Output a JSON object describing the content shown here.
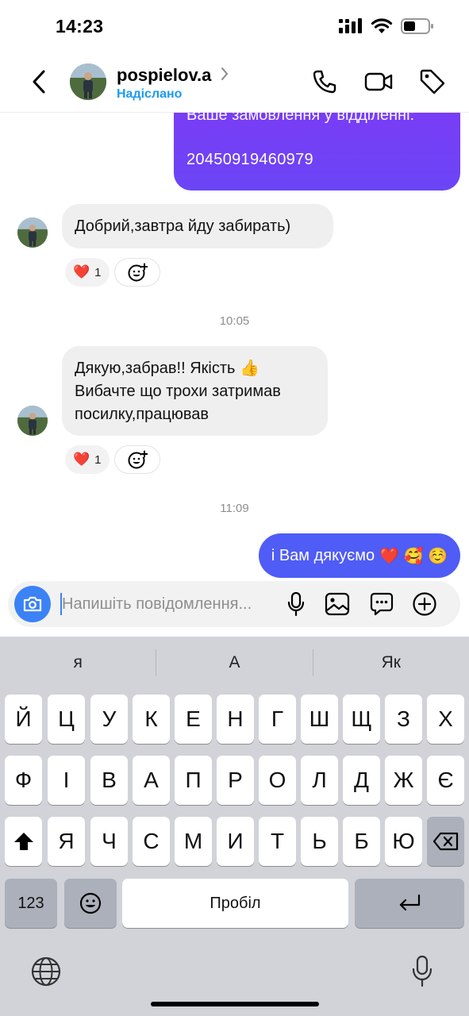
{
  "status_bar": {
    "time": "14:23"
  },
  "header": {
    "username": "pospielov.a",
    "status": "Надіслано"
  },
  "messages": {
    "outgoing_top": {
      "line1": "Ваше замовлення у відділенні:",
      "line2": "20450919460979"
    },
    "incoming_1": {
      "text": "Добрий,завтра йду забирать)",
      "reaction_emoji": "❤️",
      "reaction_count": "1"
    },
    "time_1": "10:05",
    "incoming_2": {
      "line1": "Дякую,забрав!! Якість 👍",
      "line2": "Вибачте що трохи затримав",
      "line3": "посилку,працював",
      "reaction_emoji": "❤️",
      "reaction_count": "1"
    },
    "time_2": "11:09",
    "outgoing_last": {
      "text": "і Вам дякуємо",
      "emojis": "❤️ 🥰 ☺️"
    }
  },
  "composer": {
    "placeholder": "Напишіть повідомлення..."
  },
  "keyboard": {
    "suggestions": [
      "я",
      "А",
      "Як"
    ],
    "row1": [
      "Й",
      "Ц",
      "У",
      "К",
      "Е",
      "Н",
      "Г",
      "Ш",
      "Щ",
      "З",
      "Х"
    ],
    "row2": [
      "Ф",
      "І",
      "В",
      "А",
      "П",
      "Р",
      "О",
      "Л",
      "Д",
      "Ж",
      "Є"
    ],
    "row3": [
      "Я",
      "Ч",
      "С",
      "М",
      "И",
      "Т",
      "Ь",
      "Б",
      "Ю"
    ],
    "numbers_key": "123",
    "space_key": "Пробіл"
  },
  "colors": {
    "accent_blue": "#1d9bf0",
    "outgoing_purple": "#7a3cf5",
    "outgoing_blue": "#4f5cf6",
    "incoming_gray": "#efefef"
  }
}
